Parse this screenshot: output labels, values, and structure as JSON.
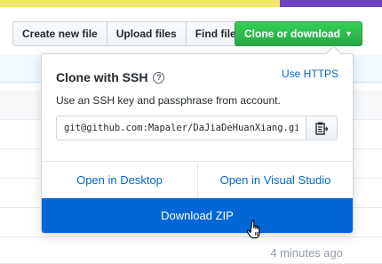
{
  "toolbar": {
    "create_new_file": "Create new file",
    "upload_files": "Upload files",
    "find_file": "Find file",
    "clone_or_download": "Clone or download"
  },
  "clone_panel": {
    "title": "Clone with SSH",
    "use_https": "Use HTTPS",
    "description": "Use an SSH key and passphrase from account.",
    "url": "git@github.com:Mapaler/DaJiaDeHuanXiang.git",
    "open_in_desktop": "Open in Desktop",
    "open_in_visual_studio": "Open in Visual Studio",
    "download_zip": "Download ZIP"
  },
  "file_list": {
    "timestamp": "4 minutes ago"
  },
  "colors": {
    "accent_blue": "#0366d6",
    "green_button": "#28a745"
  },
  "icons": [
    "help-icon",
    "clipboard-icon",
    "caret-down-icon",
    "hand-cursor-icon"
  ]
}
